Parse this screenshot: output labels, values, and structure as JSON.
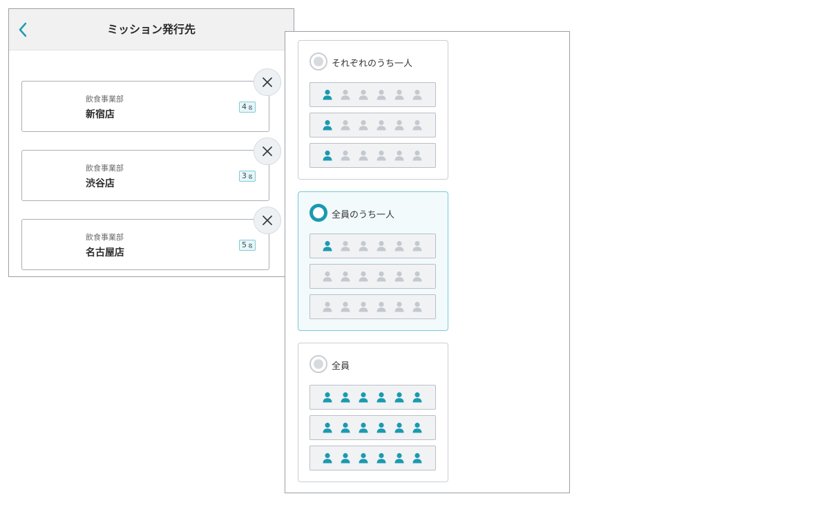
{
  "destination_panel": {
    "title": "ミッション発行先",
    "back_icon": "chevron-left-icon",
    "remove_icon": "close-icon",
    "accent_color": "#1a9ab0",
    "destinations": [
      {
        "department": "飲食事業部",
        "store": "新宿店",
        "count": "4",
        "unit": "名"
      },
      {
        "department": "飲食事業部",
        "store": "渋谷店",
        "count": "3",
        "unit": "名"
      },
      {
        "department": "飲食事業部",
        "store": "名古屋店",
        "count": "5",
        "unit": "名"
      }
    ]
  },
  "method_panel": {
    "selected_option": 1,
    "colors": {
      "active_person": "#1a9ab0",
      "inactive_person": "#c3c9cf",
      "selected_border": "#74cad4"
    },
    "options": [
      {
        "label": "それぞれのうち一人",
        "selected": false,
        "rows": [
          [
            true,
            false,
            false,
            false,
            false,
            false
          ],
          [
            true,
            false,
            false,
            false,
            false,
            false
          ],
          [
            true,
            false,
            false,
            false,
            false,
            false
          ]
        ]
      },
      {
        "label": "全員のうち一人",
        "selected": true,
        "rows": [
          [
            true,
            false,
            false,
            false,
            false,
            false
          ],
          [
            false,
            false,
            false,
            false,
            false,
            false
          ],
          [
            false,
            false,
            false,
            false,
            false,
            false
          ]
        ]
      },
      {
        "label": "全員",
        "selected": false,
        "rows": [
          [
            true,
            true,
            true,
            true,
            true,
            true
          ],
          [
            true,
            true,
            true,
            true,
            true,
            true
          ],
          [
            true,
            true,
            true,
            true,
            true,
            true
          ]
        ]
      }
    ]
  }
}
